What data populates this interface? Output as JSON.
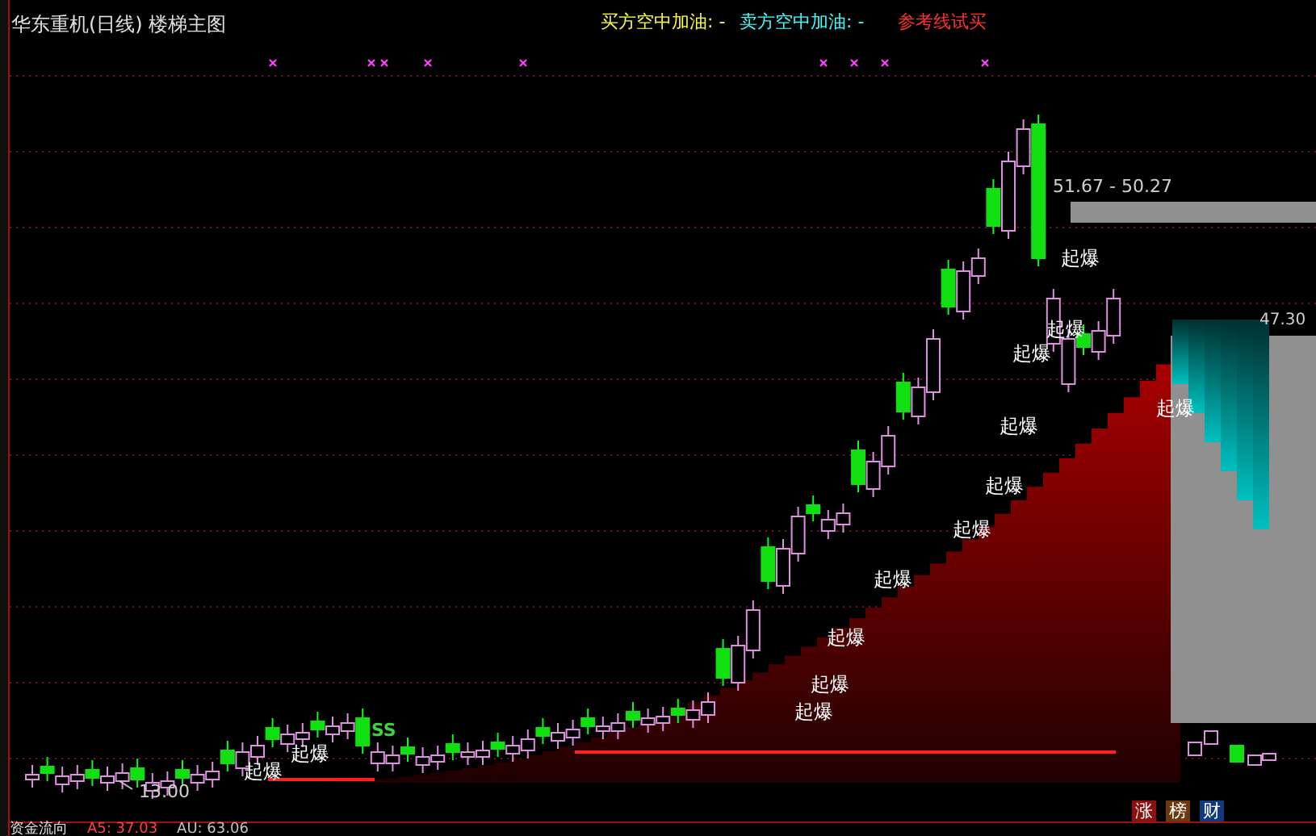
{
  "header": {
    "title": "华东重机(日线) 楼梯主图",
    "indicators": [
      {
        "label": "买方空中加油: -",
        "color": "#ffff40"
      },
      {
        "label": "卖方空中加油: -",
        "color": "#40ffff"
      },
      {
        "label": "参考线试买",
        "color": "#ff3030"
      }
    ]
  },
  "chart": {
    "signals": [
      "起爆",
      "起爆",
      "起爆",
      "起爆",
      "起爆",
      "起爆",
      "起爆",
      "起爆",
      "起爆",
      "起爆",
      "起爆",
      "起爆",
      "起爆"
    ],
    "high_label": "51.67 - 50.27",
    "low_label": "13.00",
    "range_label": "47.30",
    "ss_mark": "SS"
  },
  "badges": [
    {
      "label": "涨",
      "color": "#8b1010"
    },
    {
      "label": "榜",
      "color": "#6b3a10"
    },
    {
      "label": "财",
      "color": "#103a7a"
    }
  ],
  "footer": {
    "title": "资金流向",
    "values": [
      {
        "label": "A5: 37.03",
        "color": "#ff4040"
      },
      {
        "label": "AU: 63.06",
        "color": "#c0c0c0"
      }
    ]
  }
}
